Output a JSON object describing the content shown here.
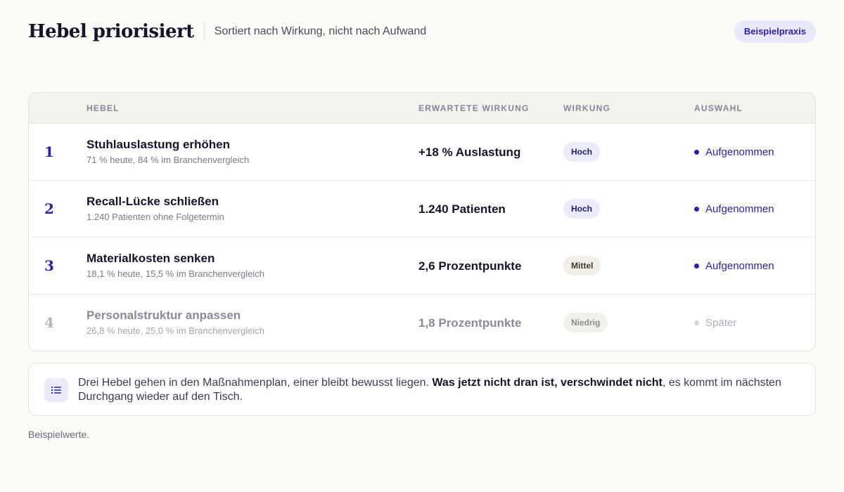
{
  "header": {
    "title": "Hebel priorisiert",
    "subtitle": "Sortiert nach Wirkung, nicht nach Aufwand",
    "badge": "Beispielpraxis"
  },
  "table": {
    "columns": {
      "hebel": "Hebel",
      "effect": "Erwartete Wirkung",
      "impact": "Wirkung",
      "selection": "Auswahl"
    },
    "rows": [
      {
        "num": "1",
        "title": "Stuhlauslastung erhöhen",
        "sub": "71 % heute, 84 % im Branchenvergleich",
        "effect": "+18 % Auslastung",
        "impact": "Hoch",
        "selection": "Aufgenommen"
      },
      {
        "num": "2",
        "title": "Recall-Lücke schließen",
        "sub": "1.240 Patienten ohne Folgetermin",
        "effect": "1.240 Patienten",
        "impact": "Hoch",
        "selection": "Aufgenommen"
      },
      {
        "num": "3",
        "title": "Materialkosten senken",
        "sub": "18,1 % heute, 15,5 % im Branchenvergleich",
        "effect": "2,6 Prozentpunkte",
        "impact": "Mittel",
        "selection": "Aufgenommen"
      },
      {
        "num": "4",
        "title": "Personalstruktur anpassen",
        "sub": "26,8 % heute, 25,0 % im Branchenvergleich",
        "effect": "1,8 Prozentpunkte",
        "impact": "Niedrig",
        "selection": "Später"
      }
    ]
  },
  "note": {
    "icon": "list-icon",
    "text_before": "Drei Hebel gehen in den Maßnahmenplan, einer bleibt bewusst liegen. ",
    "text_bold": "Was jetzt nicht dran ist, verschwindet nicht",
    "text_after": ", es kommt im nächsten Durchgang wieder auf den Tisch."
  },
  "footnote": "Beispielwerte.",
  "colors": {
    "accent": "#2a1fb0",
    "background": "#fcfbf7"
  }
}
